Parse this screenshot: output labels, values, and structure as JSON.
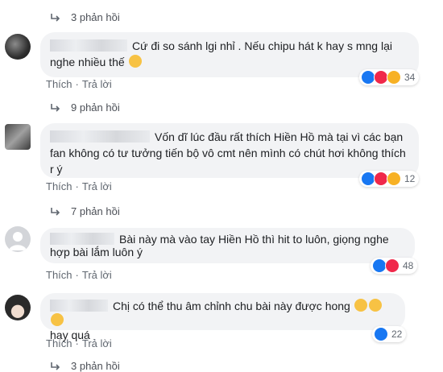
{
  "comments": [
    {
      "text": "Cứ đi so sánh lgi nhỉ . Nếu chipu hát k hay s mng lại nghe nhiều thế",
      "actions": {
        "like": "Thích",
        "reply": "Trả lời"
      },
      "reaction_count": "34",
      "replies_label": "9 phản hồi"
    },
    {
      "text": "Vốn dĩ lúc đầu rất thích Hiền Hồ mà tại vì các bạn fan không có tư tưởng tiến bộ vô cmt nên mình có chút hơi không thích r ý",
      "actions": {
        "like": "Thích",
        "reply": "Trả lời"
      },
      "reaction_count": "12",
      "replies_label": "7 phản hồi"
    },
    {
      "text": "Bài này mà vào tay Hiền Hồ thì hit to luôn, giọng nghe hợp bài lắm luôn ý",
      "actions": {
        "like": "Thích",
        "reply": "Trả lời"
      },
      "reaction_count": "48"
    },
    {
      "text": "Chị có thể thu âm chỉnh chu bài này được hong",
      "text_line2": "hay quá",
      "actions": {
        "like": "Thích",
        "reply": "Trả lời"
      },
      "reaction_count": "22",
      "replies_label": "3 phản hồi"
    }
  ],
  "top_replies_label": "3 phản hồi",
  "colors": {
    "like": "#1877f2",
    "love": "#f0284a",
    "haha": "#f7b125"
  }
}
